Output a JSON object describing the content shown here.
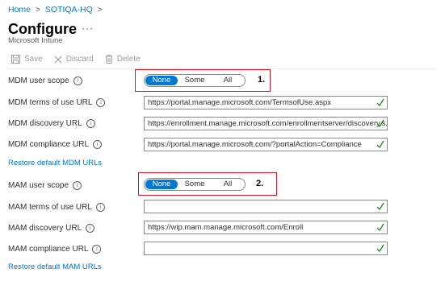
{
  "breadcrumb": {
    "home": "Home",
    "tenant": "SOTIQA-HQ"
  },
  "page": {
    "title": "Configure",
    "subtitle": "Microsoft Intune",
    "more": "···"
  },
  "toolbar": {
    "save": "Save",
    "discard": "Discard",
    "delete": "Delete"
  },
  "scope_options": [
    "None",
    "Some",
    "All"
  ],
  "mdm": {
    "scope_label": "MDM user scope",
    "scope_selected": "None",
    "callout": "1.",
    "terms_label": "MDM terms of use URL",
    "terms_value": "https://portal.manage.microsoft.com/TermsofUse.aspx",
    "discovery_label": "MDM discovery URL",
    "discovery_value": "https://enrollment.manage.microsoft.com/enrollmentserver/discovery.s...",
    "compliance_label": "MDM compliance URL",
    "compliance_value": "https://portal.manage.microsoft.com/?portalAction=Compliance",
    "restore": "Restore default MDM URLs"
  },
  "mam": {
    "scope_label": "MAM user scope",
    "scope_selected": "None",
    "callout": "2.",
    "terms_label": "MAM terms of use URL",
    "terms_value": "",
    "discovery_label": "MAM discovery URL",
    "discovery_value": "https://wip.mam.manage.microsoft.com/Enroll",
    "compliance_label": "MAM compliance URL",
    "compliance_value": "",
    "restore": "Restore default MAM URLs"
  },
  "colors": {
    "accent": "#0078d4",
    "highlight": "#e81123",
    "valid": "#107c10"
  }
}
